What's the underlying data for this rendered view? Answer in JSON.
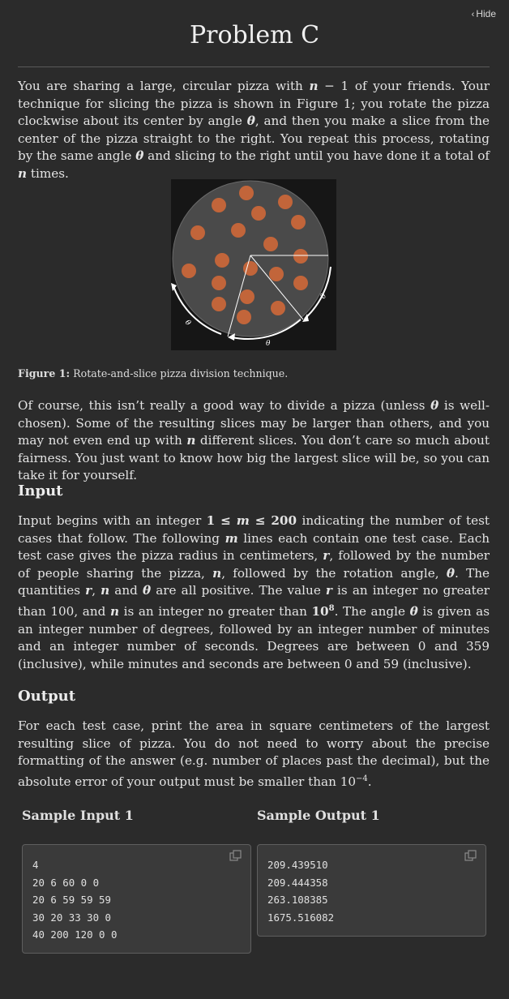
{
  "header": {
    "hide_label": "Hide",
    "title": "Problem C"
  },
  "statement": {
    "intro_html": "You are sharing a large, circular pizza with <i>n</i> − 1 of your friends. Your technique for slicing the pizza is shown in Figure 1; you rotate the pizza clockwise about its center by angle <i>θ</i>, and then you make a slice from the center of the pizza straight to the right. You repeat this process, rotating by the same angle <i>θ</i> and slicing to the right until you have done it a total of <i>n</i> times.",
    "figure": {
      "angle_label": "θ",
      "caption_label": "Figure 1:",
      "caption_text": " Rotate-and-slice pizza division technique."
    },
    "para2_html": "Of course, this isn’t really a good way to divide a pizza (unless <i>θ</i> is well-chosen). Some of the resulting slices may be larger than others, and you may not even end up with <i>n</i> different slices. You don’t care so much about fairness. You just want to know how big the largest slice will be, so you can take it for yourself."
  },
  "input_section": {
    "heading": "Input",
    "body_html": "Input begins with an integer <b>1 ≤ <i>m</i> ≤ 200</b> indicating the number of test cases that follow. The following <i>m</i> lines each contain one test case. Each test case gives the pizza radius in centimeters, <i>r</i>, followed by the number of people sharing the pizza, <i>n</i>, followed by the rotation angle, <i>θ</i>. The quantities <i>r</i>, <i>n</i> and <i>θ</i> are all positive. The value <i>r</i> is an integer no greater than 100, and <i>n</i> is an integer no greater than <b>10<sup style=\"font-size:10px\">8</sup></b>. The angle <i>θ</i> is given as an integer number of degrees, followed by an integer number of minutes and an integer number of seconds. Degrees are between 0 and 359 (inclusive), while minutes and seconds are between 0 and 59 (inclusive)."
  },
  "output_section": {
    "heading": "Output",
    "body_html": "For each test case, print the area in square centimeters of the largest resulting slice of pizza. You do not need to worry about the precise formatting of the answer (e.g. number of places past the decimal), but the absolute error of your output must be smaller than 10<sup style=\"font-size:10px\">−4</sup>."
  },
  "samples": {
    "input_label": "Sample Input 1",
    "output_label": "Sample Output 1",
    "input_text": "4\n20 6 60 0 0\n20 6 59 59 59\n30 20 33 30 0\n40 200 120 0 0",
    "output_text": "209.439510\n209.444358\n263.108385\n1675.516082"
  },
  "icons": {
    "hide": "chevron-left-icon",
    "copy": "copy-icon"
  },
  "colors": {
    "background": "#2b2b2b",
    "pizza": "#4a4a4a",
    "pepperoni": "#c2653a",
    "code_box": "#3a3a3a"
  }
}
